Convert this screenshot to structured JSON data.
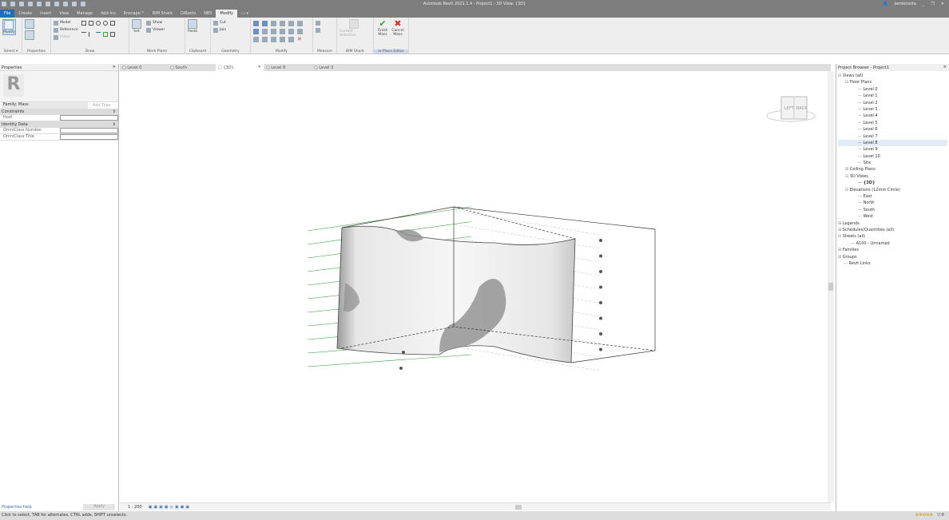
{
  "window": {
    "title": "Autodesk Revit 2021.1.4 - Project1 - 3D View: {3D}",
    "user": "jamiecosta",
    "controls": [
      "_",
      "❐",
      "✕"
    ]
  },
  "ribbon_tabs": [
    {
      "label": "File"
    },
    {
      "label": "Create"
    },
    {
      "label": "Insert"
    },
    {
      "label": "View"
    },
    {
      "label": "Manage"
    },
    {
      "label": "Add-Ins"
    },
    {
      "label": "Enscape™"
    },
    {
      "label": "BIM Shark"
    },
    {
      "label": "DiRoots"
    },
    {
      "label": "NBS"
    },
    {
      "label": "Modify",
      "active": true
    },
    {
      "label": "▭ ▾"
    }
  ],
  "ribbon": {
    "select": {
      "modify": "Modify",
      "label": "Select ▾"
    },
    "properties": {
      "label": "Properties"
    },
    "draw": {
      "model": "Model",
      "reference": "Reference",
      "plane": "Plane",
      "label": "Draw"
    },
    "work_plane": {
      "set": "Set",
      "show": "Show",
      "viewer": "Viewer",
      "label": "Work Plane"
    },
    "clipboard": {
      "paste": "Paste",
      "label": "Clipboard"
    },
    "geometry": {
      "cut": "Cut",
      "join": "Join",
      "label": "Geometry"
    },
    "modify": {
      "label": "Modify"
    },
    "measure": {
      "label": "Measure"
    },
    "bim_shark": {
      "current": "Current Selection",
      "label": "BIM Shark"
    },
    "inplace": {
      "finish": "Finish Mass",
      "cancel": "Cancel Mass",
      "label": "In-Place Editor",
      "finish_color": "#3aa040",
      "cancel_color": "#d9342b"
    }
  },
  "properties": {
    "title": "Properties",
    "family": "Family: Mass",
    "add_type": "Add Type",
    "sections": [
      {
        "name": "Constraints",
        "rows": [
          {
            "key": "Host",
            "value": ""
          }
        ]
      },
      {
        "name": "Identity Data",
        "rows": [
          {
            "key": "OmniClass Number",
            "value": ""
          },
          {
            "key": "OmniClass Title",
            "value": ""
          }
        ]
      }
    ],
    "help": "Properties help",
    "apply": "Apply"
  },
  "view_tabs": [
    {
      "label": "Level 0"
    },
    {
      "label": "South"
    },
    {
      "label": "{3D}",
      "active": true
    },
    {
      "label": "Level 8"
    },
    {
      "label": "Level 3"
    }
  ],
  "viewcube": {
    "left": "LEFT",
    "back": "BACK"
  },
  "view_bar": {
    "scale": "1 : 200"
  },
  "project_browser": {
    "title": "Project Browser - Project1",
    "items": [
      {
        "label": "Views (all)",
        "depth": 0,
        "expander": "⊟"
      },
      {
        "label": "Floor Plans",
        "depth": 1,
        "expander": "⊟"
      },
      {
        "label": "Level 0",
        "depth": 2
      },
      {
        "label": "Level 1",
        "depth": 2
      },
      {
        "label": "Level 2",
        "depth": 2
      },
      {
        "label": "Level 3",
        "depth": 2
      },
      {
        "label": "Level 4",
        "depth": 2
      },
      {
        "label": "Level 5",
        "depth": 2
      },
      {
        "label": "Level 6",
        "depth": 2
      },
      {
        "label": "Level 7",
        "depth": 2
      },
      {
        "label": "Level 8",
        "depth": 2,
        "selected": true
      },
      {
        "label": "Level 9",
        "depth": 2
      },
      {
        "label": "Level 10",
        "depth": 2
      },
      {
        "label": "Site",
        "depth": 2
      },
      {
        "label": "Ceiling Plans",
        "depth": 1,
        "expander": "⊞"
      },
      {
        "label": "3D Views",
        "depth": 1,
        "expander": "⊟"
      },
      {
        "label": "{3D}",
        "depth": 2,
        "bold": true
      },
      {
        "label": "Elevations (12mm Circle)",
        "depth": 1,
        "expander": "⊟"
      },
      {
        "label": "East",
        "depth": 2
      },
      {
        "label": "North",
        "depth": 2
      },
      {
        "label": "South",
        "depth": 2
      },
      {
        "label": "West",
        "depth": 2
      },
      {
        "label": "Legends",
        "depth": 0,
        "expander": "⊞"
      },
      {
        "label": "Schedules/Quantities (all)",
        "depth": 0,
        "expander": "⊞"
      },
      {
        "label": "Sheets (all)",
        "depth": 0,
        "expander": "⊟"
      },
      {
        "label": "A100 - Unnamed",
        "depth": 1
      },
      {
        "label": "Families",
        "depth": 0,
        "expander": "⊞"
      },
      {
        "label": "Groups",
        "depth": 0,
        "expander": "⊞"
      },
      {
        "label": "Revit Links",
        "depth": 0
      }
    ]
  },
  "status": {
    "text": "Click to select, TAB for alternates, CTRL adds, SHIFT unselects.",
    "filter": "▽:0"
  },
  "colors": {
    "file_tab": "#1f6fb8",
    "titlebar": "#7d7d7d",
    "ribbon": "#eeeeee",
    "level_line": "#3a9a3a"
  }
}
